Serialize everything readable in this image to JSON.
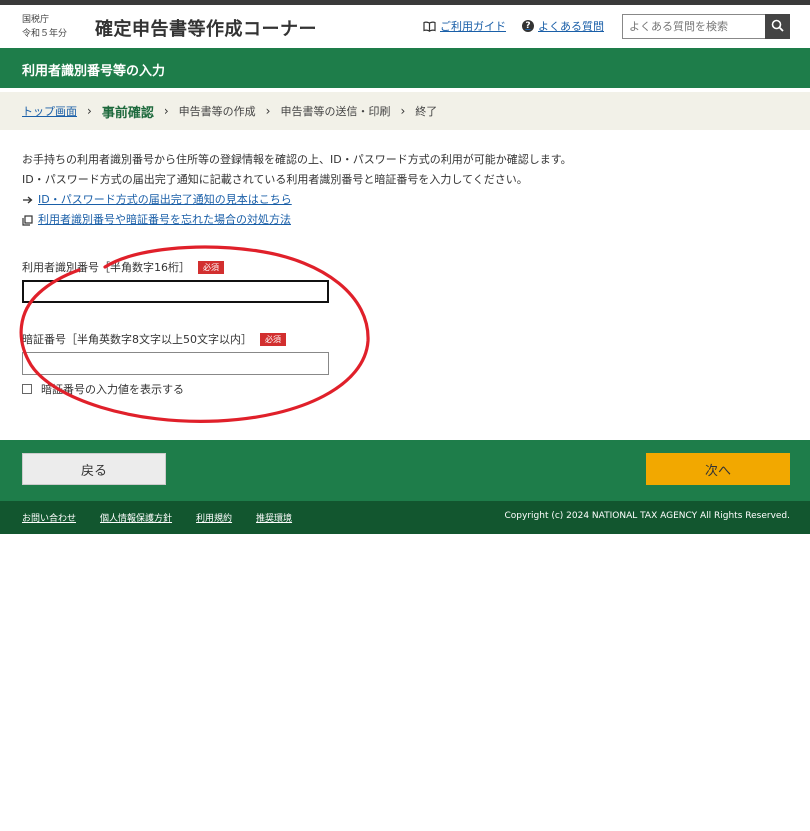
{
  "header": {
    "agency_name": "国税庁",
    "fiscal_year": "令和５年分",
    "site_title": "確定申告書等作成コーナー",
    "guide_link": "ご利用ガイド",
    "faq_link": "よくある質問",
    "search_placeholder": "よくある質問を検索"
  },
  "page_title": "利用者識別番号等の入力",
  "breadcrumb": {
    "home": "トップ画面",
    "current": "事前確認",
    "steps": [
      "申告書等の作成",
      "申告書等の送信・印刷",
      "終了"
    ]
  },
  "intro": {
    "line1": "お手持ちの利用者識別番号から住所等の登録情報を確認の上、ID・パスワード方式の利用が可能か確認します。",
    "line2": "ID・パスワード方式の届出完了通知に記載されている利用者識別番号と暗証番号を入力してください。",
    "link1": "ID・パスワード方式の届出完了通知の見本はこちら",
    "link2": "利用者識別番号や暗証番号を忘れた場合の対処方法"
  },
  "form": {
    "userid_label": "利用者識別番号［半角数字16桁］",
    "password_label": "暗証番号［半角英数字8文字以上50文字以内］",
    "required_badge": "必須",
    "userid_value": "",
    "password_value": "",
    "show_password_label": "暗証番号の入力値を表示する"
  },
  "actions": {
    "back": "戻る",
    "next": "次へ"
  },
  "footer": {
    "links": [
      "お問い合わせ",
      "個人情報保護方針",
      "利用規約",
      "推奨環境"
    ],
    "copyright": "Copyright (c) 2024 NATIONAL TAX AGENCY All Rights Reserved."
  },
  "colors": {
    "primary_green": "#1e7d4a",
    "footer_green": "#12562f",
    "next_button": "#f2a800",
    "required_red": "#d22f2f",
    "annotation_red": "#e0202a"
  }
}
